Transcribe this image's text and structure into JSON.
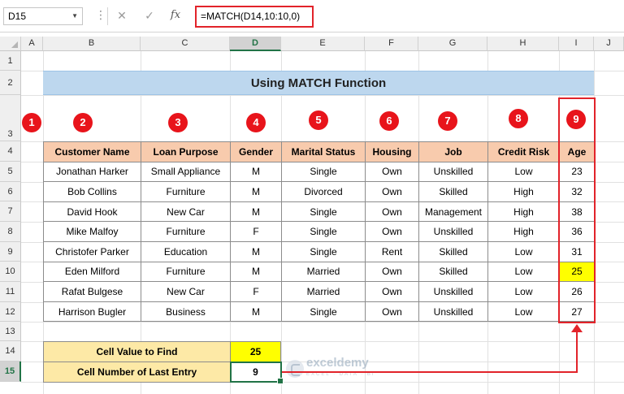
{
  "formula_bar": {
    "name_box": "D15",
    "dots": "⋮",
    "cancel_icon": "✕",
    "enter_icon": "✓",
    "fx_icon": "fx",
    "formula": "=MATCH(D14,10:10,0)"
  },
  "columns": [
    "A",
    "B",
    "C",
    "D",
    "E",
    "F",
    "G",
    "H",
    "I",
    "J"
  ],
  "rows": [
    "1",
    "2",
    "3",
    "4",
    "5",
    "6",
    "7",
    "8",
    "9",
    "10",
    "11",
    "12",
    "13",
    "14",
    "15"
  ],
  "title": "Using MATCH Function",
  "markers": [
    "1",
    "2",
    "3",
    "4",
    "5",
    "6",
    "7",
    "8",
    "9"
  ],
  "table": {
    "headers": [
      "Customer Name",
      "Loan Purpose",
      "Gender",
      "Marital Status",
      "Housing",
      "Job",
      "Credit Risk",
      "Age"
    ],
    "rows": [
      [
        "Jonathan Harker",
        "Small Appliance",
        "M",
        "Single",
        "Own",
        "Unskilled",
        "Low",
        "23"
      ],
      [
        "Bob Collins",
        "Furniture",
        "M",
        "Divorced",
        "Own",
        "Skilled",
        "High",
        "32"
      ],
      [
        "David Hook",
        "New Car",
        "M",
        "Single",
        "Own",
        "Management",
        "High",
        "38"
      ],
      [
        "Mike Malfoy",
        "Furniture",
        "F",
        "Single",
        "Own",
        "Unskilled",
        "High",
        "36"
      ],
      [
        "Christofer Parker",
        "Education",
        "M",
        "Single",
        "Rent",
        "Skilled",
        "Low",
        "31"
      ],
      [
        "Eden Milford",
        "Furniture",
        "M",
        "Married",
        "Own",
        "Skilled",
        "Low",
        "25"
      ],
      [
        "Rafat Bulgese",
        "New Car",
        "F",
        "Married",
        "Own",
        "Unskilled",
        "Low",
        "26"
      ],
      [
        "Harrison Bugler",
        "Business",
        "M",
        "Single",
        "Own",
        "Unskilled",
        "Low",
        "27"
      ]
    ]
  },
  "lookup": {
    "label1": "Cell Value to Find",
    "value1": "25",
    "label2": "Cell Number of Last Entry",
    "value2": "9"
  },
  "watermark": {
    "name": "exceldemy",
    "tagline": "EXCEL · DATA · BI"
  },
  "colors": {
    "banner": "#bdd7ee",
    "header_fill": "#f8cbad",
    "highlight": "#ffff00",
    "label_fill": "#fde9a6",
    "annotation_red": "#e2232a",
    "selection_green": "#217346"
  }
}
